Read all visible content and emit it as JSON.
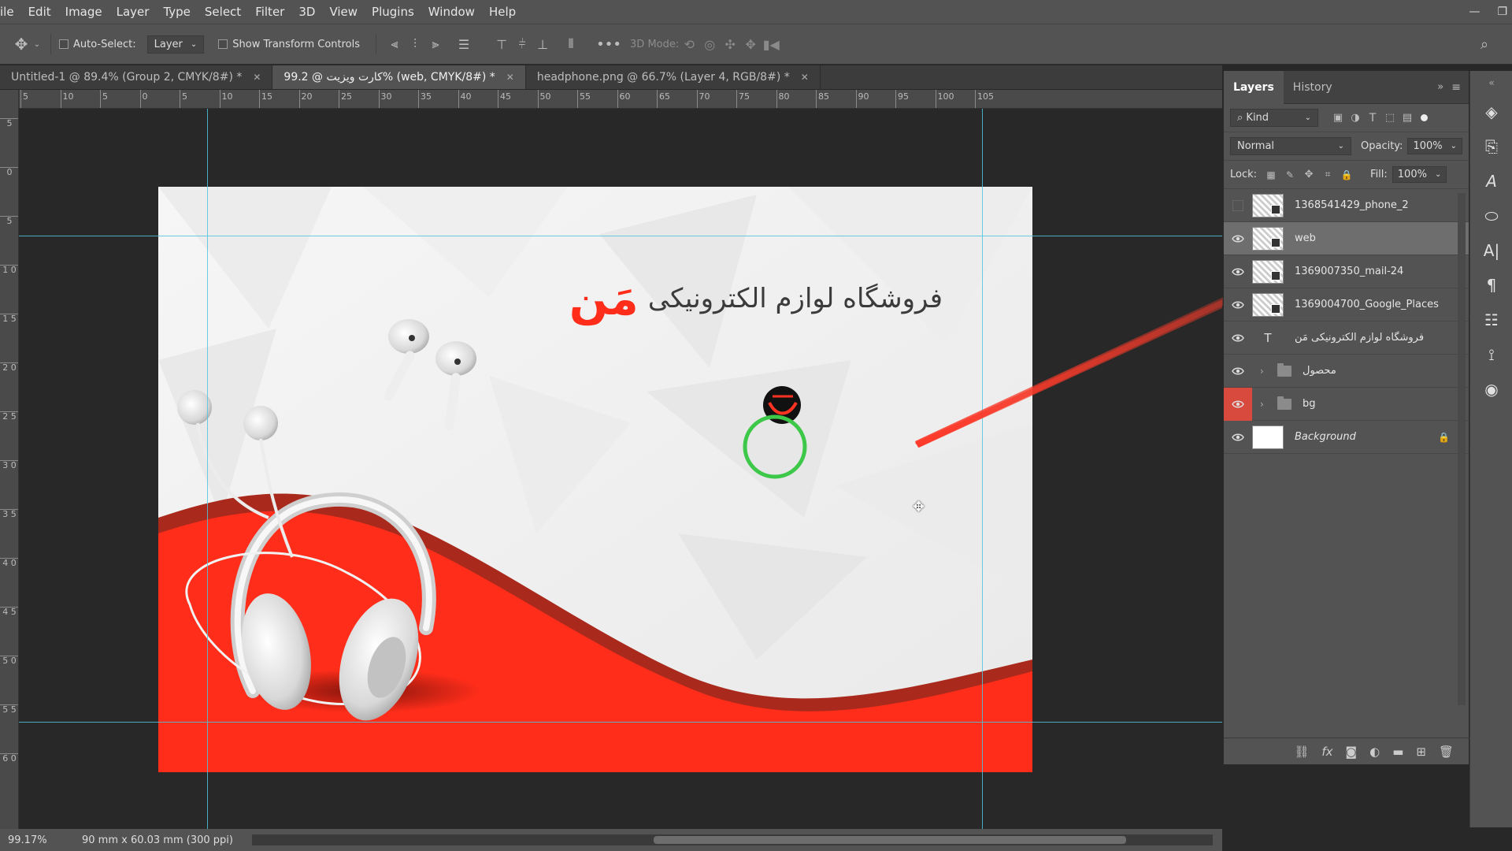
{
  "menu": [
    "ile",
    "Edit",
    "Image",
    "Layer",
    "Type",
    "Select",
    "Filter",
    "3D",
    "View",
    "Plugins",
    "Window",
    "Help"
  ],
  "options_bar": {
    "auto_select_label": "Auto-Select:",
    "auto_select_value": "Layer",
    "show_transform_label": "Show Transform Controls",
    "mode_3d_label": "3D Mode:"
  },
  "tabs": [
    {
      "label": "Untitled-1 @ 89.4% (Group 2, CMYK/8#) *",
      "active": false
    },
    {
      "label": "99.2 @ کارت ویزیت% (web, CMYK/8#) *",
      "active": true
    },
    {
      "label": "headphone.png @ 66.7% (Layer 4, RGB/8#) *",
      "active": false
    }
  ],
  "ruler_h": [
    "5",
    "10",
    "5",
    "0",
    "5",
    "10",
    "15",
    "20",
    "25",
    "30",
    "35",
    "40",
    "45",
    "50",
    "55",
    "60",
    "65",
    "70",
    "75",
    "80",
    "85",
    "90",
    "95",
    "100",
    "105"
  ],
  "ruler_v": [
    "5",
    "0",
    "5",
    "1 0",
    "1 5",
    "2 0",
    "2 5",
    "3 0",
    "3 5",
    "4 0",
    "4 5",
    "5 0",
    "5 5",
    "6 0"
  ],
  "canvas": {
    "store_text": "فروشگاه لوازم الکترونیکی",
    "brand_text": "مَن"
  },
  "status": {
    "zoom": "99.17%",
    "doc_info": "90 mm x 60.03 mm (300 ppi)"
  },
  "layers_panel": {
    "tabs": [
      "Layers",
      "History"
    ],
    "filter_kind": "Kind",
    "blend_mode": "Normal",
    "opacity_label": "Opacity:",
    "opacity_value": "100%",
    "lock_label": "Lock:",
    "fill_label": "Fill:",
    "fill_value": "100%",
    "layers": [
      {
        "name": "1368541429_phone_2",
        "visible": false,
        "kind": "smart"
      },
      {
        "name": "web",
        "visible": true,
        "kind": "smart",
        "selected": true
      },
      {
        "name": "1369007350_mail-24",
        "visible": true,
        "kind": "smart"
      },
      {
        "name": "1369004700_Google_Places",
        "visible": true,
        "kind": "smart"
      },
      {
        "name": "فروشگاه لوازم الکترونیکی مَن",
        "visible": true,
        "kind": "text"
      },
      {
        "name": "محصول",
        "visible": true,
        "kind": "group"
      },
      {
        "name": "bg",
        "visible": true,
        "kind": "group",
        "eye_highlight": true
      },
      {
        "name": "Background",
        "visible": true,
        "kind": "background",
        "locked": true
      }
    ]
  },
  "colors": {
    "accent_red": "#ff2d1a",
    "dark_red": "#b0301f",
    "guide": "#4fc6de",
    "cursor_ring": "#3ec84a"
  }
}
